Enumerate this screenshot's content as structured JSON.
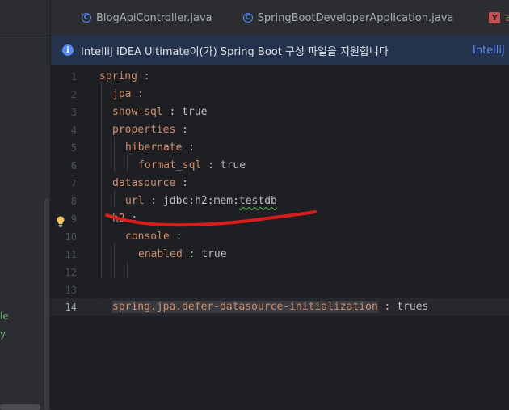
{
  "project_panel": {
    "fragments": [
      "le",
      "y"
    ]
  },
  "tabs": [
    {
      "label": "BlogApiController.java",
      "icon": "class-icon",
      "icon_glyph": "C"
    },
    {
      "label": "SpringBootDeveloperApplication.java",
      "icon": "class-icon",
      "icon_glyph": "C"
    },
    {
      "label": "ap",
      "icon": "yaml-icon",
      "icon_glyph": "Y"
    }
  ],
  "banner": {
    "icon_glyph": "i",
    "text": "IntelliJ IDEA Ultimate이(가) Spring Boot 구성 파일을 지원합니다",
    "link": "IntelliJ"
  },
  "editor": {
    "current_line": 14,
    "lines": [
      {
        "num": "1",
        "key": "spring",
        "sep": " :",
        "value": ""
      },
      {
        "num": "2",
        "key": "jpa",
        "sep": " :",
        "value": ""
      },
      {
        "num": "3",
        "key": "show-sql",
        "sep": " : ",
        "value": "true"
      },
      {
        "num": "4",
        "key": "properties",
        "sep": " :",
        "value": ""
      },
      {
        "num": "5",
        "key": "hibernate",
        "sep": " :",
        "value": ""
      },
      {
        "num": "6",
        "key": "format_sql",
        "sep": " : ",
        "value": "true"
      },
      {
        "num": "7",
        "key": "datasource",
        "sep": " :",
        "value": ""
      },
      {
        "num": "8",
        "key": "url",
        "sep": " : ",
        "value": "jdbc:h2:mem:",
        "value_underlined": "testdb"
      },
      {
        "num": "9",
        "key": "h2",
        "sep": " :",
        "value": ""
      },
      {
        "num": "10",
        "key": "console",
        "sep": " :",
        "value": ""
      },
      {
        "num": "11",
        "key": "enabled",
        "sep": " : ",
        "value": "true"
      },
      {
        "num": "12",
        "key": "",
        "sep": "",
        "value": ""
      },
      {
        "num": "13",
        "key": "",
        "sep": "",
        "value": ""
      },
      {
        "num": "14",
        "key": "spring.jpa.defer-datasource-initialization",
        "sep": " : ",
        "value": "trues"
      }
    ]
  },
  "colors": {
    "key": "#cf8e6d",
    "annotation": "#d91c1c",
    "accent": "#548af7"
  }
}
